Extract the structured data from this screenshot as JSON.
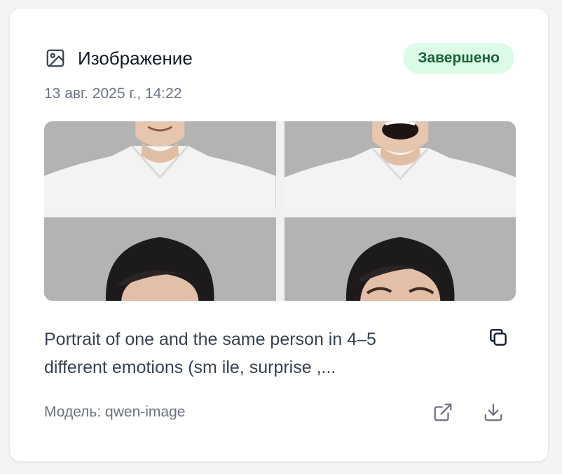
{
  "card": {
    "title": "Изображение",
    "title_icon": "image-icon",
    "status": "Завершено",
    "status_color": "#166534",
    "status_bg": "#dcfce7",
    "timestamp": "13 авг. 2025 г., 14:22",
    "image_alt": "Portrait of one and the same person in 4–5 different emotions",
    "prompt": "Portrait of one and the same person in 4–5 different emotions (sm ile, surprise ,...",
    "model_label": "Модель: qwen-image",
    "actions": {
      "copy_icon": "copy-icon",
      "open_icon": "external-link-icon",
      "download_icon": "download-icon"
    }
  }
}
